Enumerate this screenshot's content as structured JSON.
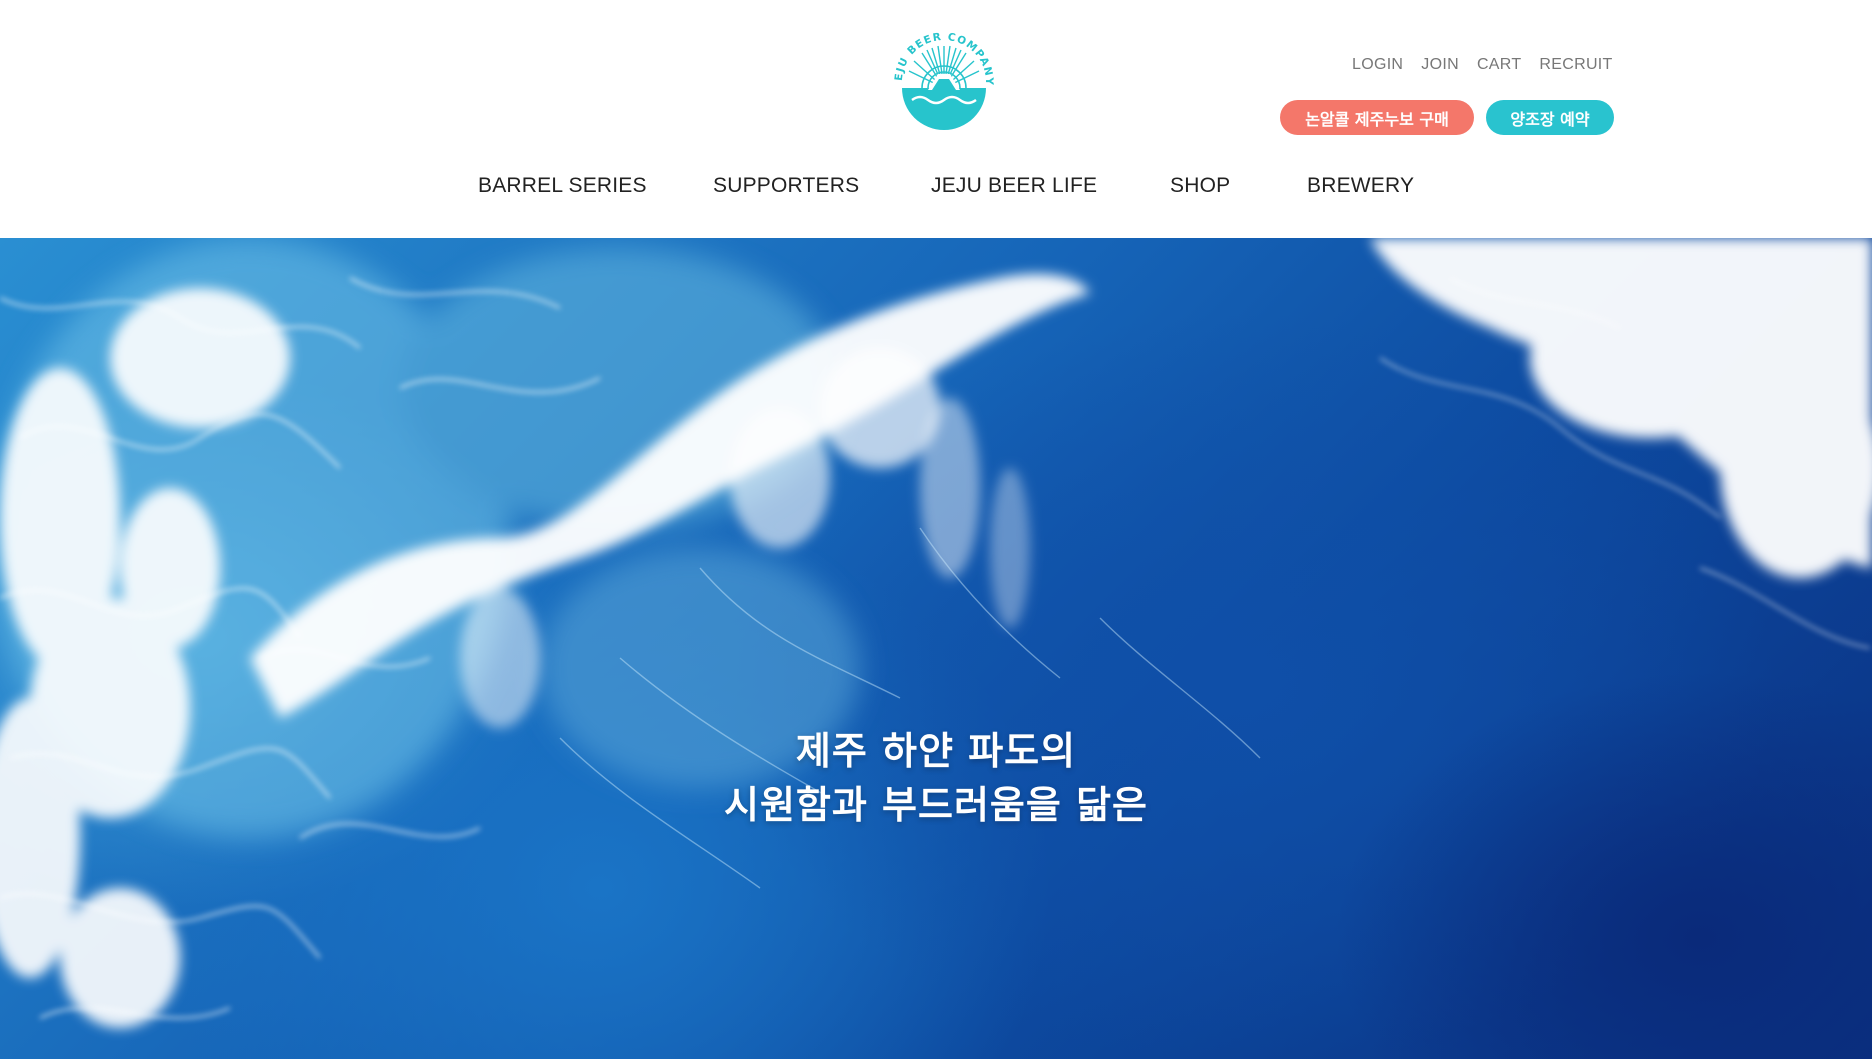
{
  "brand": {
    "logo_text": "JEJU BEER COMPANY",
    "colors": {
      "accent_teal": "#29c3cf",
      "accent_coral": "#f4776a",
      "logo_color": "#27c4cc"
    }
  },
  "util_nav": {
    "items": [
      {
        "label": "LOGIN"
      },
      {
        "label": "JOIN"
      },
      {
        "label": "CART"
      },
      {
        "label": "RECRUIT"
      }
    ]
  },
  "cta": {
    "buy_label": "논알콜 제주누보 구매",
    "brewery_label": "양조장 예약"
  },
  "main_nav": {
    "items": [
      {
        "label": "BARREL SERIES"
      },
      {
        "label": "SUPPORTERS"
      },
      {
        "label": "JEJU BEER LIFE"
      },
      {
        "label": "SHOP"
      },
      {
        "label": "BREWERY"
      }
    ]
  },
  "hero": {
    "line1": "제주 하얀 파도의",
    "line2": "시원함과 부드러움을 닮은"
  }
}
